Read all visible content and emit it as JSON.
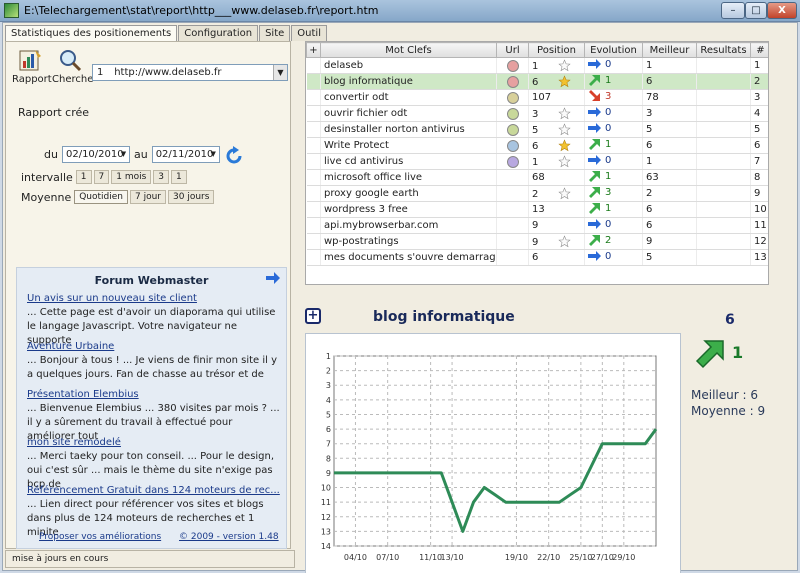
{
  "window": {
    "title": "E:\\Telechargement\\stat\\report\\http___www.delaseb.fr\\report.htm",
    "min_label": "–",
    "max_label": "□",
    "close_label": "X"
  },
  "tabs": [
    {
      "label": "Statistiques des positionements",
      "active": true
    },
    {
      "label": "Configuration",
      "active": false
    },
    {
      "label": "Site",
      "active": false
    },
    {
      "label": "Outil",
      "active": false
    }
  ],
  "toolbar": {
    "rapport_label": "Rapport",
    "cherche_label": "Cherche",
    "url_index": "1",
    "url_value": "http://www.delaseb.fr"
  },
  "report_status": "Rapport crée",
  "dates": {
    "from_label": "du",
    "from_value": "02/10/2010",
    "to_label": "au",
    "to_value": "02/11/2010"
  },
  "intervalle": {
    "label": "intervalle",
    "buttons": [
      "1",
      "7",
      "1 mois",
      "3",
      "1"
    ]
  },
  "moyenne": {
    "label": "Moyenne",
    "buttons": [
      "Quotidien",
      "7 jour",
      "30 jours"
    ],
    "selected": 0
  },
  "forum": {
    "title": "Forum Webmaster",
    "posts": [
      {
        "title": "Un avis sur un nouveau site client",
        "excerpt": "... Cette page est d'avoir un diaporama qui utilise le langage Javascript. Votre navigateur ne supporte"
      },
      {
        "title": "Aventure Urbaine",
        "excerpt": "... Bonjour à tous ! ... Je viens de finir mon site il y a quelques jours. Fan de chasse au trésor et de"
      },
      {
        "title": "Présentation Elembius",
        "excerpt": "... Bienvenue Elembius ... 380 visites par mois ? ... il y a sûrement du travail à effectué pour améliorer tout"
      },
      {
        "title": "mon site remodelé",
        "excerpt": "... Merci taeky pour ton conseil. ... Pour le design, oui c'est sûr ... mais le thème du site n'exige pas bcp de"
      },
      {
        "title": "Référencement Gratuit dans 124 moteurs de rec...",
        "excerpt": "... Lien direct pour référencer vos sites et blogs dans plus de 124 moteurs de recherches et 1 minite"
      }
    ]
  },
  "footer": {
    "improve_link": "Proposer vos améliorations",
    "version": "© 2009 - version 1.48"
  },
  "statusbar": "mise à jours en cours",
  "grid": {
    "headers": [
      "+",
      "Mot Clefs",
      "Url",
      "Position",
      "Evolution",
      "Meilleur",
      "Resultats",
      "#"
    ],
    "rows": [
      {
        "keyword": "delaseb",
        "dot": "#e6a0a0",
        "position": "1",
        "star": "empty",
        "evo_dir": "flat",
        "evo": "0",
        "best": "1",
        "results": "",
        "rank": "1"
      },
      {
        "keyword": "blog informatique",
        "dot": "#e6a0a0",
        "position": "6",
        "star": "gold",
        "evo_dir": "up",
        "evo": "1",
        "best": "6",
        "results": "",
        "rank": "2",
        "selected": true
      },
      {
        "keyword": "convertir odt",
        "dot": "#d8d09a",
        "position": "107",
        "star": "none",
        "evo_dir": "down",
        "evo": "3",
        "best": "78",
        "results": "",
        "rank": "3"
      },
      {
        "keyword": "ouvrir fichier odt",
        "dot": "#c8d89a",
        "position": "3",
        "star": "empty",
        "evo_dir": "flat",
        "evo": "0",
        "best": "3",
        "results": "",
        "rank": "4"
      },
      {
        "keyword": "desinstaller norton antivirus",
        "dot": "#c8d89a",
        "position": "5",
        "star": "empty",
        "evo_dir": "flat",
        "evo": "0",
        "best": "5",
        "results": "",
        "rank": "5"
      },
      {
        "keyword": "Write Protect",
        "dot": "#a8c4e0",
        "position": "6",
        "star": "gold",
        "evo_dir": "up",
        "evo": "1",
        "best": "6",
        "results": "",
        "rank": "6"
      },
      {
        "keyword": "live cd antivirus",
        "dot": "#b8a8e0",
        "position": "1",
        "star": "empty",
        "evo_dir": "flat",
        "evo": "0",
        "best": "1",
        "results": "",
        "rank": "7"
      },
      {
        "keyword": "microsoft office live",
        "dot": "",
        "position": "68",
        "star": "none",
        "evo_dir": "up",
        "evo": "1",
        "best": "63",
        "results": "",
        "rank": "8"
      },
      {
        "keyword": "proxy google earth",
        "dot": "",
        "position": "2",
        "star": "empty",
        "evo_dir": "up",
        "evo": "3",
        "best": "2",
        "results": "",
        "rank": "9"
      },
      {
        "keyword": "wordpress 3 free",
        "dot": "",
        "position": "13",
        "star": "none",
        "evo_dir": "up",
        "evo": "1",
        "best": "6",
        "results": "",
        "rank": "10"
      },
      {
        "keyword": "api.mybrowserbar.com",
        "dot": "",
        "position": "9",
        "star": "none",
        "evo_dir": "flat",
        "evo": "0",
        "best": "6",
        "results": "",
        "rank": "11"
      },
      {
        "keyword": "wp-postratings",
        "dot": "",
        "position": "9",
        "star": "empty",
        "evo_dir": "up",
        "evo": "2",
        "best": "9",
        "results": "",
        "rank": "12"
      },
      {
        "keyword": "mes documents s'ouvre demarrage wind",
        "dot": "",
        "position": "6",
        "star": "none",
        "evo_dir": "flat",
        "evo": "0",
        "best": "5",
        "results": "",
        "rank": "13"
      }
    ]
  },
  "detail": {
    "title": "blog informatique",
    "position": "6",
    "evolution": "1",
    "best_label": "Meilleur : 6",
    "avg_label": "Moyenne : 9",
    "accent": "#2e8b57"
  },
  "chart_data": {
    "type": "line",
    "title": "",
    "xlabel": "",
    "ylabel": "",
    "y_inverted": true,
    "ylim": [
      1,
      14
    ],
    "yticks": [
      1,
      2,
      3,
      4,
      5,
      6,
      7,
      8,
      9,
      10,
      11,
      12,
      13,
      14
    ],
    "x_tick_labels": [
      "04/10",
      "07/10",
      "11/10",
      "13/10",
      "19/10",
      "22/10",
      "25/10",
      "27/10",
      "29/10"
    ],
    "series": [
      {
        "color": "#2e8b57",
        "x": [
          "02/10",
          "03/10",
          "04/10",
          "05/10",
          "06/10",
          "07/10",
          "08/10",
          "09/10",
          "10/10",
          "11/10",
          "12/10",
          "13/10",
          "14/10",
          "15/10",
          "16/10",
          "17/10",
          "18/10",
          "19/10",
          "20/10",
          "21/10",
          "22/10",
          "23/10",
          "24/10",
          "25/10",
          "26/10",
          "27/10",
          "28/10",
          "29/10",
          "30/10",
          "31/10",
          "01/11"
        ],
        "values": [
          9,
          9,
          9,
          9,
          9,
          9,
          9,
          9,
          9,
          9,
          9,
          11,
          13,
          11,
          10,
          10.5,
          11,
          11,
          11,
          11,
          11,
          11,
          10.5,
          10,
          8.5,
          7,
          7,
          7,
          7,
          7,
          6
        ]
      }
    ]
  }
}
